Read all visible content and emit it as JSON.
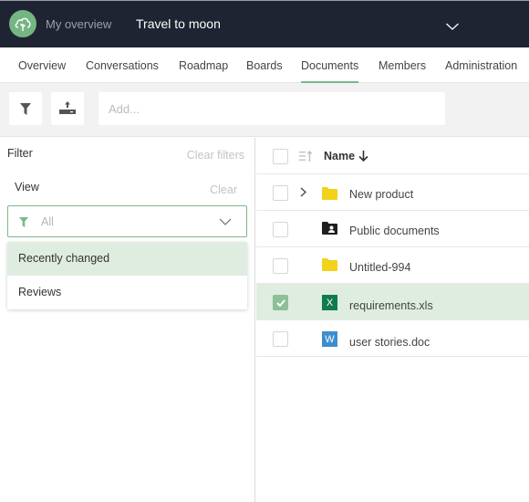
{
  "topbar": {
    "logo_icon": "cloud-icon",
    "my_overview": "My overview",
    "project_title": "Travel to moon",
    "project_menu_icon": "chevron-down-icon",
    "colors": {
      "background": "#1f2432",
      "logo": "#75b583"
    }
  },
  "tabs": [
    {
      "label": "Overview",
      "active": false
    },
    {
      "label": "Conversations",
      "active": false
    },
    {
      "label": "Roadmap",
      "active": false
    },
    {
      "label": "Boards",
      "active": false
    },
    {
      "label": "Documents",
      "active": true
    },
    {
      "label": "Members",
      "active": false
    },
    {
      "label": "Administration",
      "active": false
    }
  ],
  "toolbar": {
    "filter_icon": "filter-icon",
    "upload_icon": "upload-icon",
    "add_placeholder": "Add...",
    "add_value": ""
  },
  "filter_panel": {
    "title": "Filter",
    "clear_filters": "Clear filters",
    "view_label": "View",
    "view_clear": "Clear",
    "view_select": {
      "icon": "filter-icon",
      "value": "All",
      "chevron": "chevron-down-icon"
    },
    "dropdown_options": [
      {
        "label": "Recently changed",
        "highlighted": true
      },
      {
        "label": "Reviews",
        "highlighted": false
      }
    ]
  },
  "file_list": {
    "header": {
      "sort_icon": "sort-icon",
      "name_label": "Name",
      "sort_direction_icon": "arrow-down-icon"
    },
    "rows": [
      {
        "name": "New product",
        "type": "folder",
        "icon": "folder-icon",
        "expandable": true,
        "checked": false
      },
      {
        "name": "Public documents",
        "type": "shared-folder",
        "icon": "shared-folder-icon",
        "expandable": false,
        "checked": false
      },
      {
        "name": "Untitled-994",
        "type": "folder",
        "icon": "folder-icon",
        "expandable": false,
        "checked": false
      },
      {
        "name": "requirements.xls",
        "type": "excel",
        "icon": "excel-icon",
        "badge": "X",
        "expandable": false,
        "checked": true
      },
      {
        "name": "user stories.doc",
        "type": "word",
        "icon": "word-icon",
        "badge": "W",
        "expandable": false,
        "checked": false
      }
    ]
  },
  "colors": {
    "accent": "#7bb78a",
    "selected_row": "#deede0",
    "folder": "#f2d21b",
    "excel": "#107c4e",
    "word": "#3d8ed0"
  }
}
